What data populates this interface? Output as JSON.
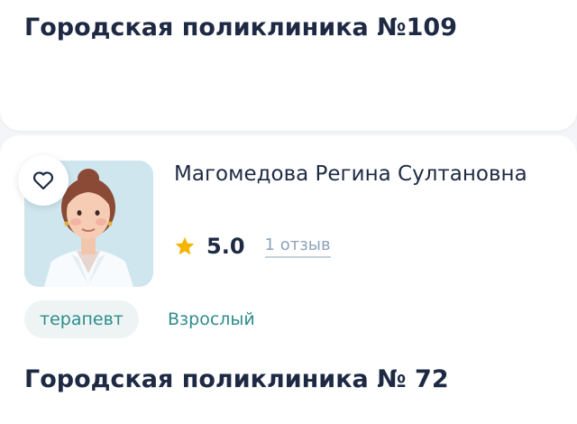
{
  "clinic_top": {
    "title": "Городская поликлиника №109"
  },
  "doctor": {
    "name": "Магомедова Регина Султановна",
    "rating": "5.0",
    "reviews": "1 отзыв",
    "specialty": "терапевт",
    "age_group": "Взрослый"
  },
  "clinic_bottom": {
    "title": "Городская поликлиника № 72"
  },
  "icons": {
    "favorite": "heart-icon",
    "rating": "star-icon"
  },
  "colors": {
    "title": "#1e2a44",
    "accent_teal": "#2f8c8c",
    "chip_bg": "#eef4f4",
    "star": "#f5b400",
    "muted": "#8ea3b8"
  }
}
